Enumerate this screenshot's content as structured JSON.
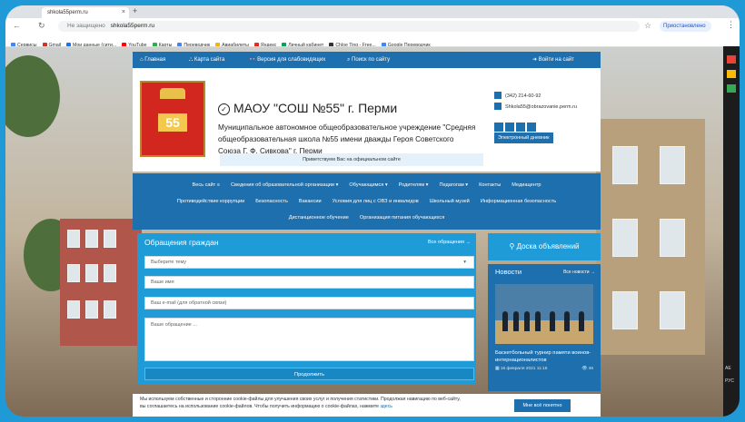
{
  "browser": {
    "tab_title": "shkola55perm.ru",
    "tab_close": "×",
    "new_tab": "+",
    "nav_back": "←",
    "nav_reload": "↻",
    "url_secure_label": "Не защищено",
    "url": "shkola55perm.ru",
    "star_icon": "☆",
    "sync_label": "Приостановлено",
    "menu_icon": "⋮",
    "bookmarks": [
      "Сервисы",
      "Gmail",
      "Мои данные (сити...",
      "YouTube",
      "Карты",
      "Переводчик",
      "Авиабилеты",
      "Яндекс",
      "Личный кабинет",
      "Chloe Ting - Free...",
      "Google Переводчик"
    ],
    "bookmark_colors": [
      "#4285f4",
      "#d93025",
      "#1a73e8",
      "#ff0000",
      "#34a853",
      "#4285f4",
      "#f4b400",
      "#d93025",
      "#0f9d58",
      "#333333",
      "#4285f4"
    ]
  },
  "topnav": {
    "home": "Главная",
    "sitemap": "Карта сайта",
    "low_vision": "Версия для слабовидящих",
    "search": "Поиск по сайту",
    "login": "Войти на сайт"
  },
  "header": {
    "emblem_number": "55",
    "title": "МАОУ \"СОШ №55\" г. Перми",
    "description": "Муниципальное автономное общеобразовательное учреждение \"Средняя общеобразовательная школа №55 имени дважды Героя Советского Союза Г. Ф. Сивкова\" г. Перми",
    "greeting": "Приветствуем Вас на официальном сайте",
    "phone": "(342) 214-60-92",
    "email": "Shkola55@obrazovanie.perm.ru",
    "diary": "Электронный дневник"
  },
  "mainnav": {
    "row1": [
      "Весь сайт ≡",
      "Сведения об образовательной организации ▾",
      "Обучающимся ▾",
      "Родителям ▾",
      "Педагогам ▾",
      "Контакты",
      "Медиацентр"
    ],
    "row2": [
      "Противодействие коррупции",
      "Безопасность",
      "Вакансии",
      "Условия для лиц с ОВЗ и инвалидов",
      "Школьный музей",
      "Информационная безопасность"
    ],
    "row3": [
      "Дистанционное обучение",
      "Организация питания обучающихся"
    ]
  },
  "appeal_form": {
    "title": "Обращения граждан",
    "all_link": "Все обращения →",
    "topic_select": "Выберите тему",
    "name_placeholder": "Ваше имя",
    "email_placeholder": "Ваш e-mail (для обратной связи)",
    "message_placeholder": "Ваше обращение ...",
    "submit": "Продолжить"
  },
  "sidebar": {
    "board_title": "Доска объявлений",
    "news_title": "Новости",
    "news_all": "Все новости →",
    "news_item_title": "Баскетбольный турнир памяти воинов-интернационалистов",
    "news_item_date": "16 февраля 2021 11:15",
    "news_item_views": "46"
  },
  "cookie": {
    "text": "Мы используем собственные и сторонние cookie-файлы для улучшения своих услуг и получения статистики. Продолжая навигацию по веб-сайту, вы соглашаетесь на использование cookie-файлов. Чтобы получить информацию о cookie-файлах, нажмите",
    "link": "здесь",
    "button": "Мне всё понятно"
  },
  "taskbar": {
    "lang": "РУС",
    "time_label": "АЕ"
  }
}
